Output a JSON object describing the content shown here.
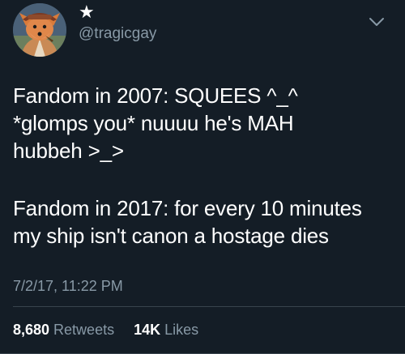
{
  "tweet": {
    "display_name": "★",
    "handle": "@tragicgay",
    "paragraph1": [
      "Fandom in 2007: SQUEES ^_^",
      "*glomps you* nuuuu he's MAH",
      "hubbeh >_>"
    ],
    "paragraph2": [
      "Fandom in 2017: for every 10 minutes",
      "my ship isn't canon a hostage dies"
    ],
    "timestamp": "7/2/17, 11:22 PM",
    "retweets": {
      "value": "8,680",
      "label": "Retweets"
    },
    "likes": {
      "value": "14K",
      "label": "Likes"
    }
  },
  "icons": {
    "avatar": "fox-avatar-icon",
    "menu": "chevron-down-icon"
  },
  "colors": {
    "background": "#141d26",
    "text": "#ffffff",
    "secondary": "#8899a6"
  }
}
